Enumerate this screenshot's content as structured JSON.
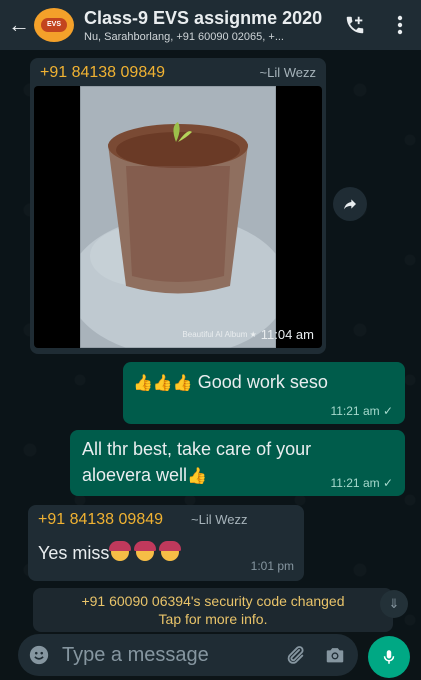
{
  "header": {
    "title": "Class-9 EVS assignme 2020",
    "subtitle": "Nu, Sarahborlang, +91 60090 02065, +...",
    "avatar_text": "EVS"
  },
  "messages": {
    "image_msg": {
      "sender": "+91 84138 09849",
      "alias": "~Lil Wezz",
      "watermark": "Beautiful AI Album ★",
      "time": "11:04 am"
    },
    "out1": {
      "text": "Good work seso",
      "time": "11:21 am ✓"
    },
    "out2": {
      "text": "All thr best, take care of your aloevera well",
      "time": "11:21 am ✓"
    },
    "in2": {
      "sender": "+91 84138 09849",
      "alias": "~Lil Wezz",
      "text": "Yes miss",
      "time": "1:01 pm"
    },
    "system": {
      "line1": "+91 60090 06394's security code changed",
      "line2": "Tap for more info."
    }
  },
  "input": {
    "placeholder": "Type a message"
  },
  "colors": {
    "header_bg": "#1f2c34",
    "outgoing_bg": "#005c4b",
    "incoming_bg": "#1f2c34",
    "accent": "#00a884",
    "sender_name": "#f0b232"
  }
}
